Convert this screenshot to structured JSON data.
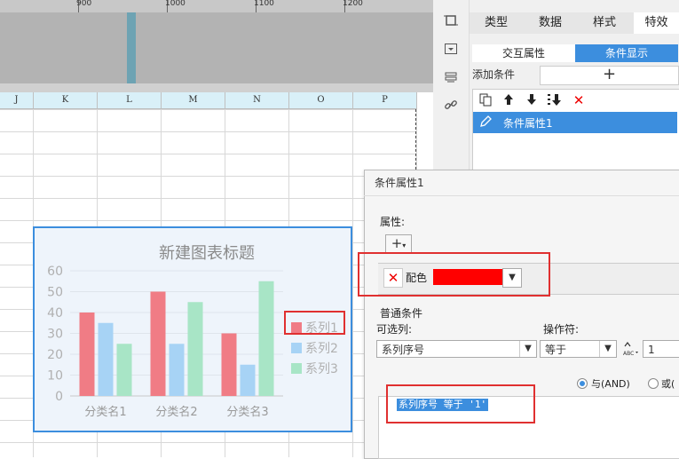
{
  "ruler": {
    "labels": [
      "900",
      "1000",
      "1100",
      "1200"
    ]
  },
  "columns": [
    "J",
    "K",
    "L",
    "M",
    "N",
    "O",
    "P"
  ],
  "panel": {
    "tabs": [
      "类型",
      "数据",
      "样式",
      "特效"
    ],
    "subtabs": [
      "交互属性",
      "条件显示"
    ],
    "add_condition_label": "添加条件",
    "add_button": "+",
    "condition_item": "条件属性1"
  },
  "dialog": {
    "title": "条件属性1",
    "property_label": "属性:",
    "plus": "+",
    "color_label": "配色",
    "color_value": "#ff0000",
    "normal_condition": "普通条件",
    "optional_col_label": "可选列:",
    "operator_label": "操作符:",
    "column_value": "系列序号",
    "operator_value": "等于",
    "operand_value": "1",
    "and_label": "与(AND)",
    "or_label": "或(",
    "expression": "系列序号 等于 '1'"
  },
  "chart_data": {
    "type": "bar",
    "title": "新建图表标题",
    "categories": [
      "分类名1",
      "分类名2",
      "分类名3"
    ],
    "series": [
      {
        "name": "系列1",
        "color": "#f07c85",
        "values": [
          40,
          50,
          30
        ]
      },
      {
        "name": "系列2",
        "color": "#a7d3f5",
        "values": [
          35,
          25,
          15
        ]
      },
      {
        "name": "系列3",
        "color": "#a8e5c6",
        "values": [
          25,
          45,
          55
        ]
      }
    ],
    "yticks": [
      "0",
      "10",
      "20",
      "30",
      "40",
      "50",
      "60"
    ],
    "ylim": [
      0,
      60
    ],
    "grid": true,
    "legend": "right"
  }
}
